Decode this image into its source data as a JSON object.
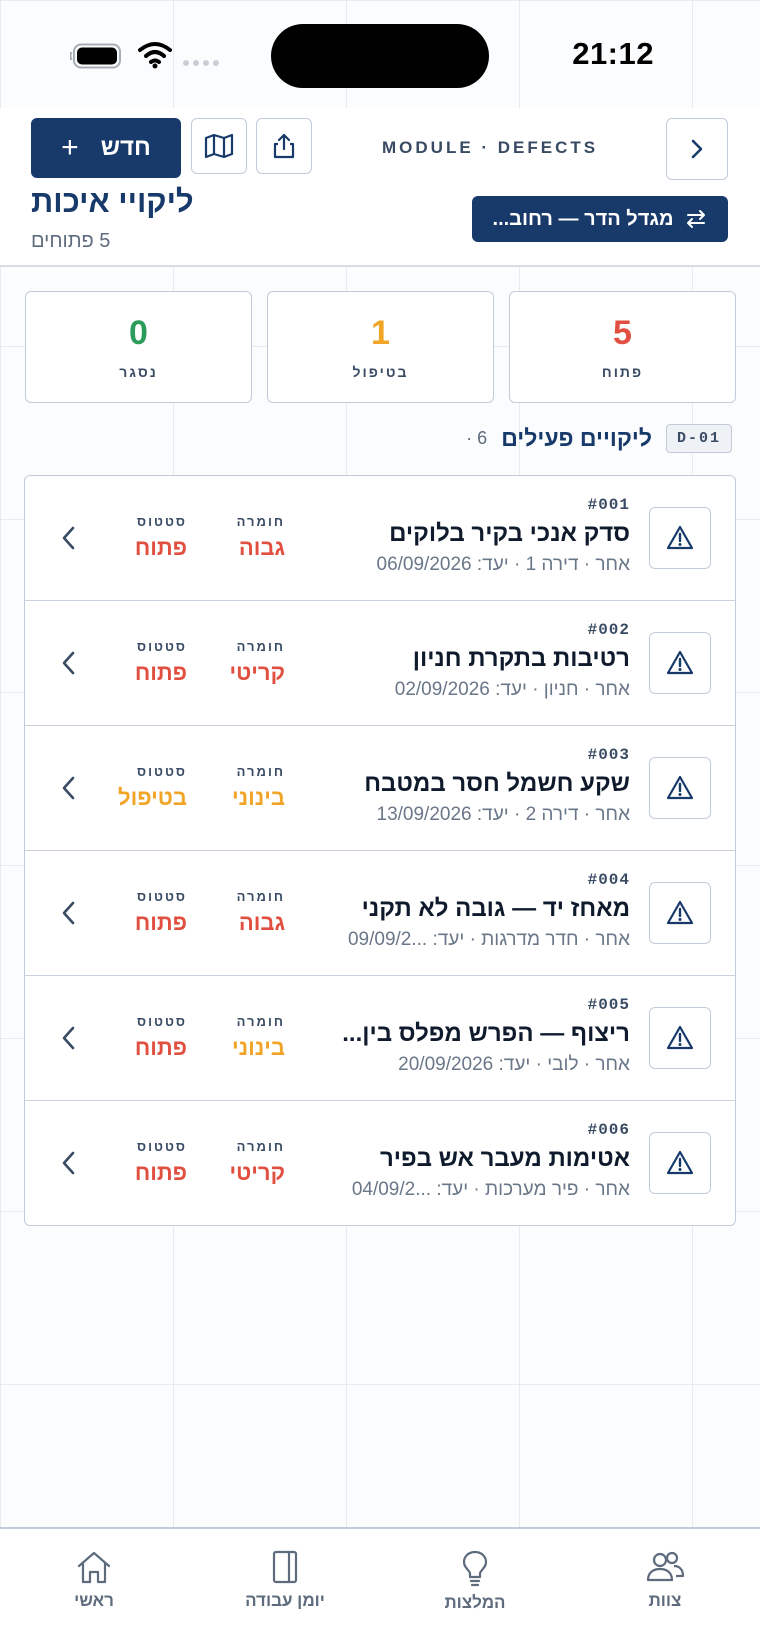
{
  "status_bar": {
    "time": "21:12"
  },
  "header": {
    "new_label": "חדש",
    "new_plus": "+",
    "module_label": "MODULE · DEFECTS",
    "project_label": "מגדל הדר — רחוב...",
    "title": "ליקויי איכות",
    "subtitle": "5 פתוחים"
  },
  "stats": [
    {
      "value": "5",
      "label": "פתוח",
      "color": "#e04f3f"
    },
    {
      "value": "1",
      "label": "בטיפול",
      "color": "#f0a526"
    },
    {
      "value": "0",
      "label": "נסגר",
      "color": "#2c9c5b"
    }
  ],
  "section": {
    "code": "D-01",
    "title": "ליקויים פעילים",
    "count": "· 6"
  },
  "field_labels": {
    "severity": "חומרה",
    "status": "סטטוס"
  },
  "colors": {
    "red": "#e04f3f",
    "orange": "#f0a526",
    "navy": "#173a6b"
  },
  "defects": [
    {
      "number": "#001",
      "title": "סדק אנכי בקיר בלוקים",
      "meta": "אחר · דירה 1 · יעד: 06/09/2026",
      "severity": "גבוה",
      "severity_color": "#e04f3f",
      "status": "פתוח",
      "status_color": "#e04f3f"
    },
    {
      "number": "#002",
      "title": "רטיבות בתקרת חניון",
      "meta": "אחר · חניון · יעד: 02/09/2026",
      "severity": "קריטי",
      "severity_color": "#e04f3f",
      "status": "פתוח",
      "status_color": "#e04f3f"
    },
    {
      "number": "#003",
      "title": "שקע חשמל חסר במטבח",
      "meta": "אחר · דירה 2 · יעד: 13/09/2026",
      "severity": "בינוני",
      "severity_color": "#f0a526",
      "status": "בטיפול",
      "status_color": "#f0a526"
    },
    {
      "number": "#004",
      "title": "מאחז יד — גובה לא תקני",
      "meta": "אחר · חדר מדרגות · יעד: ...09/09/2",
      "severity": "גבוה",
      "severity_color": "#e04f3f",
      "status": "פתוח",
      "status_color": "#e04f3f"
    },
    {
      "number": "#005",
      "title": "ריצוף — הפרש מפלס בין...",
      "meta": "אחר · לובי · יעד: 20/09/2026",
      "severity": "בינוני",
      "severity_color": "#f0a526",
      "status": "פתוח",
      "status_color": "#e04f3f"
    },
    {
      "number": "#006",
      "title": "אטימות מעבר אש בפיר",
      "meta": "אחר · פיר מערכות · יעד: ...04/09/2",
      "severity": "קריטי",
      "severity_color": "#e04f3f",
      "status": "פתוח",
      "status_color": "#e04f3f"
    }
  ],
  "tabs": [
    {
      "label": "ראשי",
      "icon": "home-icon"
    },
    {
      "label": "יומן עבודה",
      "icon": "journal-icon"
    },
    {
      "label": "המלצות",
      "icon": "lightbulb-icon"
    },
    {
      "label": "צוות",
      "icon": "team-icon"
    }
  ]
}
